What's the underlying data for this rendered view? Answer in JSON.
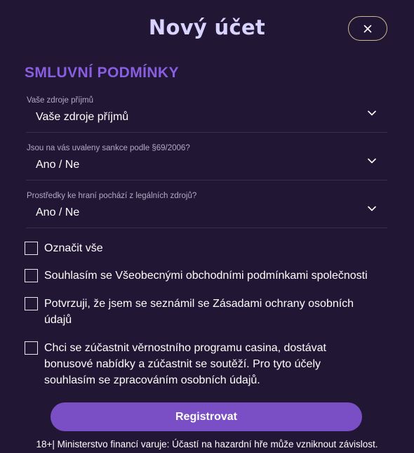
{
  "modal": {
    "title": "Nový účet",
    "close_icon": "close-icon"
  },
  "section": {
    "title": "SMLUVNÍ PODMÍNKY"
  },
  "selects": [
    {
      "label": "Vaše zdroje příjmů",
      "value": "Vaše zdroje příjmů",
      "icon": "chevron-down-icon"
    },
    {
      "label": "Jsou na vás uvaleny sankce podle §69/2006?",
      "value": "Ano / Ne",
      "icon": "chevron-down-icon"
    },
    {
      "label": "Prostředky ke hraní pochází z legálních zdrojů?",
      "value": "Ano / Ne",
      "icon": "chevron-down-icon"
    }
  ],
  "checkboxes": [
    {
      "label": "Označit vše",
      "checked": false
    },
    {
      "label": "Souhlasím se Všeobecnými obchodními podmínkami společnosti",
      "checked": false
    },
    {
      "label": "Potvrzuji, že jsem se seznámil se Zásadami ochrany osobních údajů",
      "checked": false
    },
    {
      "label": "Chci se zúčastnit věrnostního programu casina, dostávat bonusové nabídky a zúčastnit se soutěží. Pro tyto účely souhlasím se zpracováním osobních údajů.",
      "checked": false
    }
  ],
  "register_button": {
    "label": "Registrovat"
  },
  "footer": {
    "warning": "18+| Ministerstvo financí varuje: Účastí na hazardní hře může vzniknout závislost."
  },
  "colors": {
    "background": "#211634",
    "accent": "#7a4fc6",
    "section_title": "#8a5ee0",
    "title": "#d9d3ff",
    "close_border": "#c9b98d"
  }
}
